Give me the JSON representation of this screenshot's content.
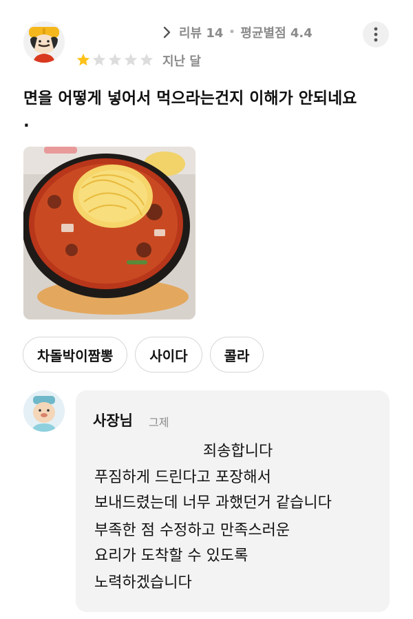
{
  "review": {
    "review_count": "리뷰 14",
    "average_rating": "평균별점 4.4",
    "rating": 1,
    "max_rating": 5,
    "date": "지난 달",
    "text": "면을 어떻게 넣어서 먹으라는건지 이해가 안되네요\n.",
    "photo_icon": "food-photo-jjamppong",
    "menu_tags": [
      "차돌박이짬뽕",
      "사이다",
      "콜라"
    ]
  },
  "owner_reply": {
    "name": "사장님",
    "date": "그제",
    "lines": [
      "죄송합니다",
      "푸짐하게 드린다고 포장해서",
      "보내드렸는데 너무 과했던거 같습니다",
      "부족한 점 수정하고 만족스러운",
      "요리가 도착할 수 있도록",
      "노력하겠습니다"
    ]
  },
  "colors": {
    "star_filled": "#ffc21a",
    "star_empty": "#dddddd",
    "meta_text": "#8a8a8a",
    "reply_background": "#f3f3f3"
  },
  "icons": {
    "reviewer_avatar": "reviewer-avatar-character",
    "owner_avatar": "owner-avatar-character",
    "more": "more-vertical-icon",
    "meta_arrow": "chevron-right-icon"
  }
}
